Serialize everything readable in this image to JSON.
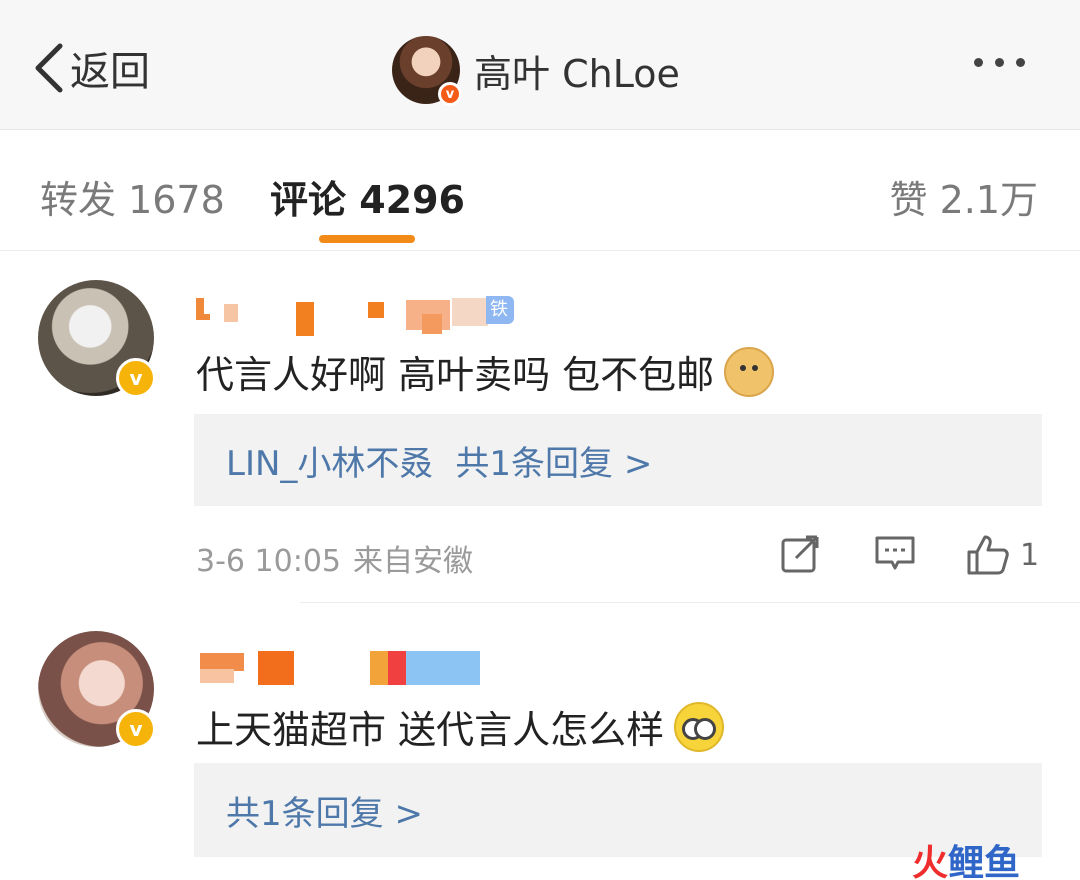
{
  "header": {
    "back_label": "返回",
    "title": "高叶 ChLoe"
  },
  "tabs": {
    "repost": "转发 1678",
    "comments": "评论 4296",
    "likes": "赞 2.1万"
  },
  "comments": [
    {
      "badge": "铁粉1",
      "text": "代言人好啊 高叶卖吗 包不包邮",
      "emoji": "doge-emoji",
      "reply_user": "LIN_小林不叒",
      "reply_count": "共1条回复 >",
      "time": "3-6 10:05",
      "location": "来自安徽",
      "like_count": "1"
    },
    {
      "text": "上天猫超市 送代言人怎么样",
      "emoji": "glasses-emoji",
      "reply_count": "共1条回复 >"
    }
  ],
  "watermark": {
    "fire": "火",
    "fish": "鲤鱼"
  },
  "colors": {
    "accent_orange": "#f28a18",
    "link_blue": "#4e78a9",
    "verified_gold": "#f6b40b"
  }
}
